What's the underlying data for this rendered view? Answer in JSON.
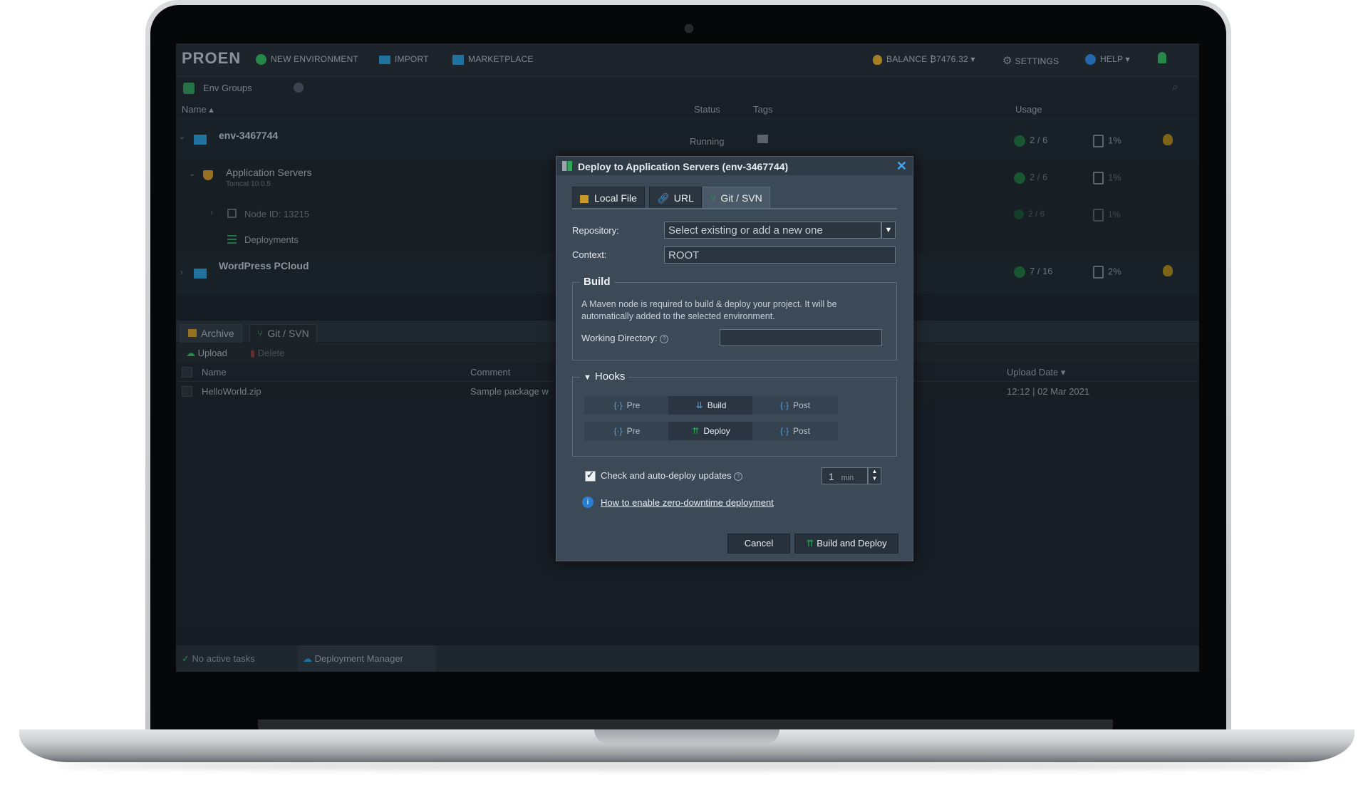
{
  "topbar": {
    "logo": "PROEN",
    "new_environment": "NEW ENVIRONMENT",
    "import": "IMPORT",
    "marketplace": "MARKETPLACE",
    "balance": "BALANCE ₿7476.32",
    "settings": "SETTINGS",
    "help": "HELP"
  },
  "envbar": {
    "env_groups": "Env Groups"
  },
  "table_header": {
    "name": "Name",
    "status": "Status",
    "tags": "Tags",
    "usage": "Usage"
  },
  "environments": [
    {
      "name": "env-3467744",
      "status": "Running",
      "cloudlets": "2 / 6",
      "disk": "1%"
    },
    {
      "name": "WordPress PCloud",
      "cloudlets": "7 / 16",
      "disk": "2%"
    }
  ],
  "env_children": {
    "app_servers": "Application Servers",
    "app_servers_sub": "Tomcat 10.0.5",
    "app_cloudlets": "2 / 6",
    "app_disk": "1%",
    "node": "Node ID: 13215",
    "node_cloudlets": "2 / 6",
    "node_disk": "1%",
    "deployments": "Deployments"
  },
  "deploy_panel": {
    "tab_archive": "Archive",
    "tab_git": "Git / SVN",
    "upload": "Upload",
    "delete": "Delete",
    "col_name": "Name",
    "col_comment": "Comment",
    "col_upload_date": "Upload Date",
    "row_name": "HelloWorld.zip",
    "row_comment": "Sample package w",
    "row_date": "12:12 | 02 Mar 2021"
  },
  "statusbar": {
    "tasks": "No active tasks",
    "deployment_manager": "Deployment Manager"
  },
  "modal": {
    "title": "Deploy to Application Servers (env-3467744)",
    "tab_local": "Local File",
    "tab_url": "URL",
    "tab_git": "Git / SVN",
    "repository_label": "Repository:",
    "repository_placeholder": "Select existing or add a new one",
    "context_label": "Context:",
    "context_value": "ROOT",
    "build_legend": "Build",
    "build_note": "A Maven node is required to build & deploy your project. It will be automatically added to the selected environment.",
    "working_dir_label": "Working Directory:",
    "hooks_legend": "Hooks",
    "hook_pre": "Pre",
    "hook_build": "Build",
    "hook_post": "Post",
    "hook_deploy": "Deploy",
    "auto_deploy_label": "Check and auto-deploy updates",
    "interval_value": "1",
    "interval_unit": "min",
    "zero_downtime_link": "How to enable zero-downtime deployment",
    "cancel": "Cancel",
    "build_deploy": "Build and Deploy"
  },
  "colors": {
    "accent": "#4aa3e8",
    "green": "#2fa85a",
    "gold": "#c79a2a",
    "modal_bg": "#3c4957"
  }
}
